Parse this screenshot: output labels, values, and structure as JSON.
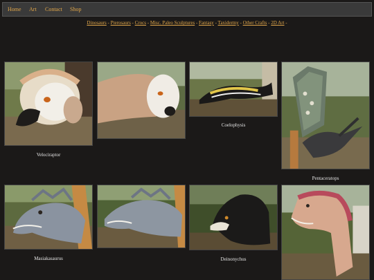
{
  "nav": {
    "items": [
      "Home",
      "Art",
      "Contact",
      "Shop"
    ]
  },
  "categories": [
    "Dinosaurs",
    "Pterosaurs",
    "Crocs",
    "Misc. Paleo Sculptures",
    "Fantasy",
    "Taxidermy",
    "Other Crafts",
    "2D Art"
  ],
  "category_separator": " - ",
  "category_trailing": " -",
  "gallery": {
    "captions": {
      "velociraptor": "Velociraptor",
      "coelophysis": "Coelophysis",
      "pentaceratops": "Pentaceratops",
      "masiakasaurus": "Masiakasaurus",
      "deinonychus": "Deinonychus"
    }
  }
}
